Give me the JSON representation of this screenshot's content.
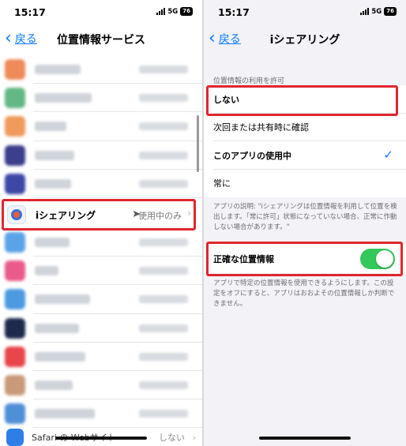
{
  "status_bar": {
    "time": "15:17",
    "network": "5G",
    "battery": "76"
  },
  "left": {
    "back_label": "戻る",
    "title": "位置情報サービス",
    "highlighted_app": {
      "name": "iシェアリング",
      "status": "使用中のみ"
    },
    "bottom_row": {
      "name": "Safari の Webサイト",
      "status": "しない"
    }
  },
  "right": {
    "back_label": "戻る",
    "title": "iシェアリング",
    "section_header": "位置情報の利用を許可",
    "options": [
      {
        "label": "しない",
        "selected": false
      },
      {
        "label": "次回または共有時に確認",
        "selected": false
      },
      {
        "label": "このアプリの使用中",
        "selected": true
      },
      {
        "label": "常に",
        "selected": false
      }
    ],
    "app_explanation": "アプリの説明: \"iシェアリングは位置情報を利用して位置を検出します。「常に許可」状態になっていない場合、正常に作動しない場合があります。\"",
    "precise_location": {
      "label": "正確な位置情報",
      "enabled": true
    },
    "precise_footnote": "アプリで特定の位置情報を使用できるようにします。この設定をオフにすると、アプリはおおよその位置情報しか判断できません。"
  },
  "colors": {
    "accent": "#0a7aff",
    "highlight": "#e0262d",
    "toggle_on": "#34c759"
  }
}
